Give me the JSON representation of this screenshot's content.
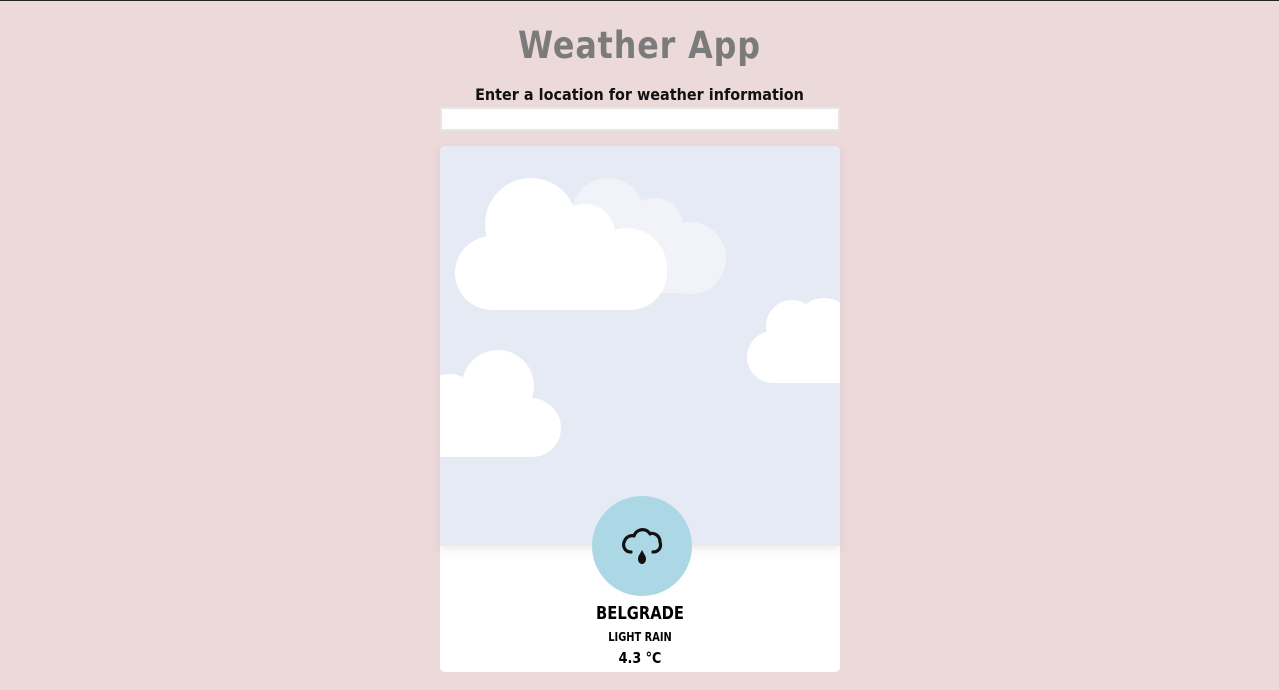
{
  "header": {
    "title": "Weather App",
    "prompt": "Enter a location for weather information"
  },
  "search": {
    "value": "",
    "placeholder": ""
  },
  "weather": {
    "city": "BELGRADE",
    "condition": "LIGHT RAIN",
    "temperature": "4.3 °C",
    "icon": "cloud-rain-icon"
  },
  "colors": {
    "background": "#ecd9da",
    "title": "#7b7b7b",
    "sky": "#e5eaf4",
    "icon_circle": "#acd8e5",
    "card": "#ffffff"
  }
}
